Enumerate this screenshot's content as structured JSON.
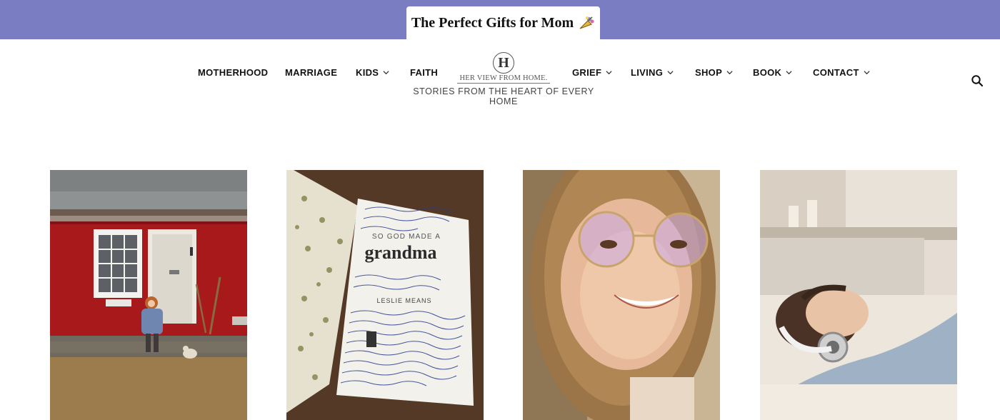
{
  "promo": {
    "text": "The Perfect Gifts for Mom",
    "icon": "gift-bouquet-icon"
  },
  "brand": {
    "logo_letter": "H",
    "logo_word": "HER VIEW FROM HOME.",
    "tagline": "STORIES FROM THE HEART OF EVERY HOME"
  },
  "nav": {
    "motherhood": "MOTHERHOOD",
    "marriage": "MARRIAGE",
    "kids": "KIDS",
    "faith": "FAITH",
    "grief": "GRIEF",
    "living": "LIVING",
    "shop": "SHOP",
    "book": "BOOK",
    "contact": "CONTACT"
  },
  "search": {
    "icon": "search-icon"
  },
  "cards": [
    {
      "image": "girl-in-front-of-red-barn"
    },
    {
      "image": "signed-grandma-book"
    },
    {
      "image": "smiling-girl-with-glasses"
    },
    {
      "image": "woman-with-headphones"
    }
  ],
  "book_cover": {
    "line1": "SO GOD MADE A",
    "title": "grandma",
    "author": "LESLIE MEANS"
  },
  "colors": {
    "promo_bar": "#7b7dc3",
    "text": "#111111"
  }
}
